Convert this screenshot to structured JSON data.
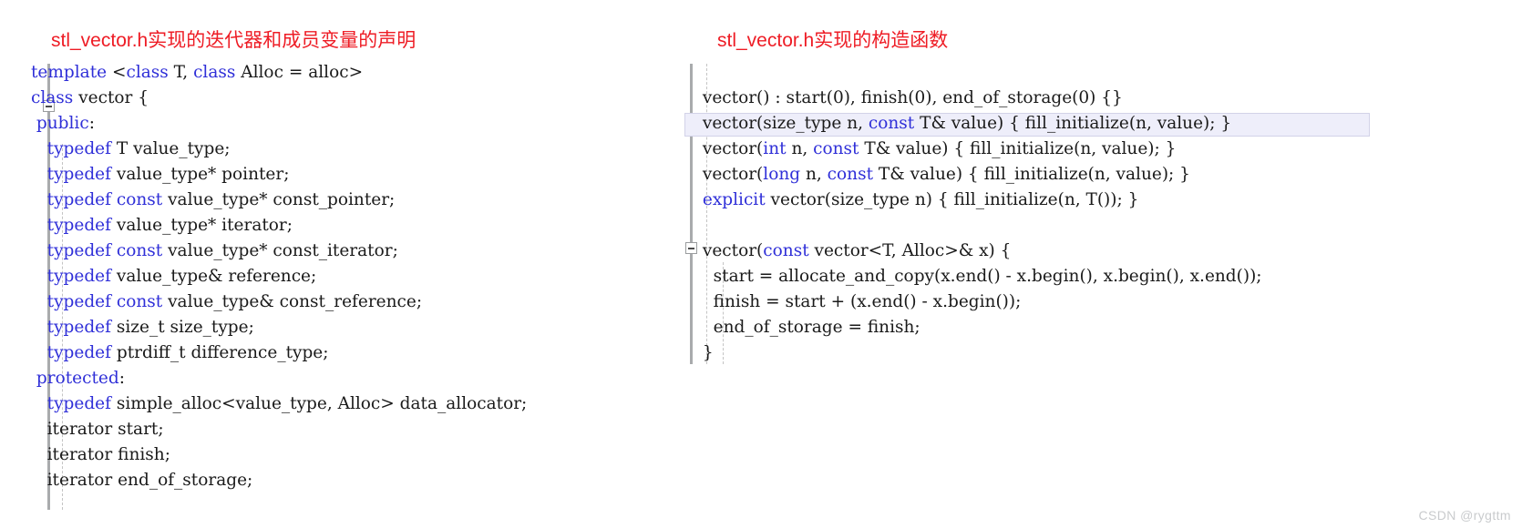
{
  "watermark": "CSDN @rygttm",
  "theme": {
    "keyword_color": "#2f2fd8",
    "text_color": "#1a1a1a",
    "title_color": "#ee1c25",
    "gutter_color": "#a9abad",
    "indent_guide_color": "#c4c4c4",
    "highlight_background": "#eeeefa",
    "highlight_border": "#d2d2e8",
    "watermark_color": "#c9cbcd",
    "page_background": "#ffffff"
  },
  "panels": [
    {
      "id": "iterator-and-member-declarations",
      "title": "stl_vector.h实现的迭代器和成员变量的声明",
      "fold_markers": [
        {
          "line_index": 1,
          "state": "expanded",
          "glyph": "minus"
        }
      ],
      "lines": [
        {
          "indent": 0,
          "tokens": [
            {
              "t": "template ",
              "k": true
            },
            {
              "t": "<",
              "k": false
            },
            {
              "t": "class",
              "k": true
            },
            {
              "t": " T, ",
              "k": false
            },
            {
              "t": "class",
              "k": true
            },
            {
              "t": " Alloc = ",
              "k": false
            },
            {
              "t": "alloc",
              "k": false
            },
            {
              "t": ">",
              "k": false
            }
          ]
        },
        {
          "indent": 0,
          "tokens": [
            {
              "t": "class",
              "k": true
            },
            {
              "t": " vector {",
              "k": false
            }
          ]
        },
        {
          "indent": 0,
          "tokens": [
            {
              "t": " ",
              "k": false
            },
            {
              "t": "public",
              "k": true
            },
            {
              "t": ":",
              "k": false
            }
          ]
        },
        {
          "indent": 0,
          "tokens": [
            {
              "t": "   ",
              "k": false
            },
            {
              "t": "typedef",
              "k": true
            },
            {
              "t": " T value_type;",
              "k": false
            }
          ]
        },
        {
          "indent": 0,
          "tokens": [
            {
              "t": "   ",
              "k": false
            },
            {
              "t": "typedef",
              "k": true
            },
            {
              "t": " value_type* pointer;",
              "k": false
            }
          ]
        },
        {
          "indent": 0,
          "tokens": [
            {
              "t": "   ",
              "k": false
            },
            {
              "t": "typedef",
              "k": true
            },
            {
              "t": " ",
              "k": false
            },
            {
              "t": "const",
              "k": true
            },
            {
              "t": " value_type* const_pointer;",
              "k": false
            }
          ]
        },
        {
          "indent": 0,
          "tokens": [
            {
              "t": "   ",
              "k": false
            },
            {
              "t": "typedef",
              "k": true
            },
            {
              "t": " value_type* iterator;",
              "k": false
            }
          ]
        },
        {
          "indent": 0,
          "tokens": [
            {
              "t": "   ",
              "k": false
            },
            {
              "t": "typedef",
              "k": true
            },
            {
              "t": " ",
              "k": false
            },
            {
              "t": "const",
              "k": true
            },
            {
              "t": " value_type* const_iterator;",
              "k": false
            }
          ]
        },
        {
          "indent": 0,
          "tokens": [
            {
              "t": "   ",
              "k": false
            },
            {
              "t": "typedef",
              "k": true
            },
            {
              "t": " value_type& reference;",
              "k": false
            }
          ]
        },
        {
          "indent": 0,
          "tokens": [
            {
              "t": "   ",
              "k": false
            },
            {
              "t": "typedef",
              "k": true
            },
            {
              "t": " ",
              "k": false
            },
            {
              "t": "const",
              "k": true
            },
            {
              "t": " value_type& const_reference;",
              "k": false
            }
          ]
        },
        {
          "indent": 0,
          "tokens": [
            {
              "t": "   ",
              "k": false
            },
            {
              "t": "typedef",
              "k": true
            },
            {
              "t": " size_t size_type;",
              "k": false
            }
          ]
        },
        {
          "indent": 0,
          "tokens": [
            {
              "t": "   ",
              "k": false
            },
            {
              "t": "typedef",
              "k": true
            },
            {
              "t": " ptrdiff_t difference_type;",
              "k": false
            }
          ]
        },
        {
          "indent": 0,
          "tokens": [
            {
              "t": " ",
              "k": false
            },
            {
              "t": "protected",
              "k": true
            },
            {
              "t": ":",
              "k": false
            }
          ]
        },
        {
          "indent": 0,
          "tokens": [
            {
              "t": "   ",
              "k": false
            },
            {
              "t": "typedef",
              "k": true
            },
            {
              "t": " simple_alloc<value_type, Alloc> data_allocator;",
              "k": false
            }
          ]
        },
        {
          "indent": 0,
          "tokens": [
            {
              "t": "   iterator start;",
              "k": false
            }
          ]
        },
        {
          "indent": 0,
          "tokens": [
            {
              "t": "   iterator finish;",
              "k": false
            }
          ]
        },
        {
          "indent": 0,
          "tokens": [
            {
              "t": "   iterator end_of_storage;",
              "k": false
            }
          ]
        }
      ]
    },
    {
      "id": "constructors",
      "title": "stl_vector.h实现的构造函数",
      "highlighted_line_index": 2,
      "fold_markers": [
        {
          "line_index": 7,
          "state": "expanded",
          "glyph": "minus"
        }
      ],
      "lines": [
        {
          "indent": 0,
          "tokens": [
            {
              "t": "",
              "k": false
            }
          ]
        },
        {
          "indent": 0,
          "tokens": [
            {
              "t": " vector() : start(0), finish(0), end_of_storage(0) {}",
              "k": false
            }
          ]
        },
        {
          "indent": 0,
          "tokens": [
            {
              "t": " vector(size_type n, ",
              "k": false
            },
            {
              "t": "const",
              "k": true
            },
            {
              "t": " T& value) { fill_initialize(n, value); }",
              "k": false
            }
          ]
        },
        {
          "indent": 0,
          "tokens": [
            {
              "t": " vector(",
              "k": false
            },
            {
              "t": "int",
              "k": true
            },
            {
              "t": " n, ",
              "k": false
            },
            {
              "t": "const",
              "k": true
            },
            {
              "t": " T& value) { fill_initialize(n, value); }",
              "k": false
            }
          ]
        },
        {
          "indent": 0,
          "tokens": [
            {
              "t": " vector(",
              "k": false
            },
            {
              "t": "long",
              "k": true
            },
            {
              "t": " n, ",
              "k": false
            },
            {
              "t": "const",
              "k": true
            },
            {
              "t": " T& value) { fill_initialize(n, value); }",
              "k": false
            }
          ]
        },
        {
          "indent": 0,
          "tokens": [
            {
              "t": " ",
              "k": false
            },
            {
              "t": "explicit",
              "k": true
            },
            {
              "t": " vector(size_type n) { fill_initialize(n, T()); }",
              "k": false
            }
          ]
        },
        {
          "indent": 0,
          "tokens": [
            {
              "t": "",
              "k": false
            }
          ]
        },
        {
          "indent": 0,
          "tokens": [
            {
              "t": " vector(",
              "k": false
            },
            {
              "t": "const",
              "k": true
            },
            {
              "t": " vector<T, Alloc>& x) {",
              "k": false
            }
          ]
        },
        {
          "indent": 0,
          "tokens": [
            {
              "t": "   start = allocate_and_copy(x.end() - x.begin(), x.begin(), x.end());",
              "k": false
            }
          ]
        },
        {
          "indent": 0,
          "tokens": [
            {
              "t": "   finish = start + (x.end() - x.begin());",
              "k": false
            }
          ]
        },
        {
          "indent": 0,
          "tokens": [
            {
              "t": "   end_of_storage = finish;",
              "k": false
            }
          ]
        },
        {
          "indent": 0,
          "tokens": [
            {
              "t": " }",
              "k": false
            }
          ]
        }
      ]
    }
  ]
}
